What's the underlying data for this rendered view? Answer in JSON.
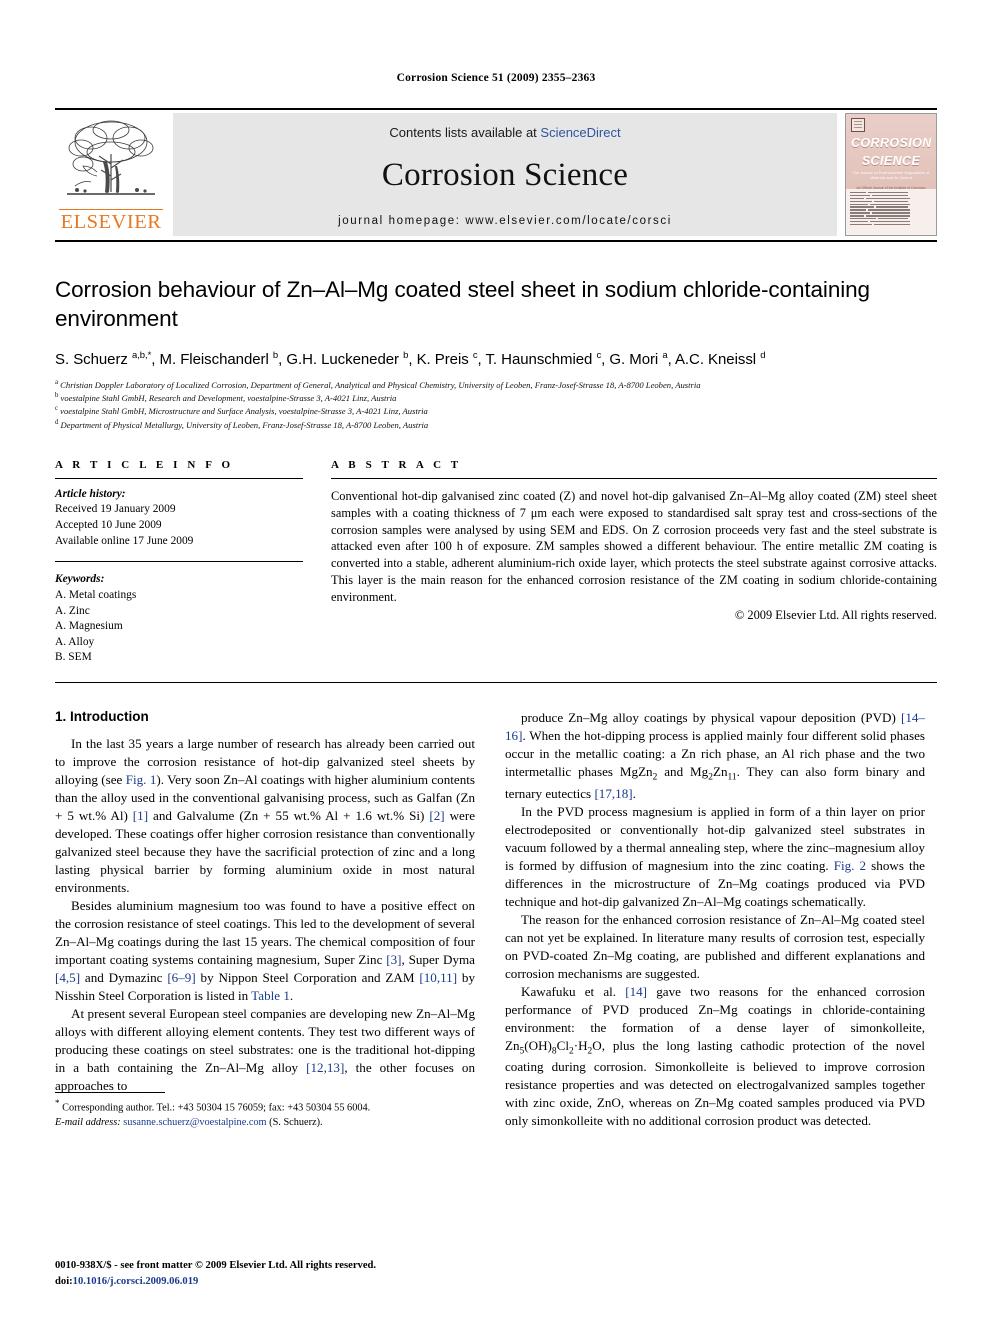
{
  "running_head": "Corrosion Science 51 (2009) 2355–2363",
  "masthead": {
    "contents_prefix": "Contents lists available at ",
    "contents_link": "ScienceDirect",
    "journal_name": "Corrosion Science",
    "homepage": "journal homepage: www.elsevier.com/locate/corsci",
    "publisher_word": "ELSEVIER",
    "accent_orange": "#E87722",
    "link_blue": "#2f54a0",
    "panel_grey": "#e6e6e6"
  },
  "cover": {
    "title_line1": "CORROSION",
    "title_line2": "SCIENCE",
    "subtitle": "The Journal on Environmental Degradation of Materials and its Control",
    "subtitle2": "An Official Journal of the Institute of Corrosion",
    "contents_caption": "CONTENTS",
    "background": "#e2c2b9"
  },
  "article": {
    "title": "Corrosion behaviour of Zn–Al–Mg coated steel sheet in sodium chloride-containing environment",
    "authors_html": "S. Schuerz <sup>a,b,*</sup>, M. Fleischanderl <sup>b</sup>, G.H. Luckeneder <sup>b</sup>, K. Preis <sup>c</sup>, T. Haunschmied <sup>c</sup>, G. Mori <sup>a</sup>, A.C. Kneissl <sup>d</sup>",
    "affiliations": [
      "Christian Doppler Laboratory of Localized Corrosion, Department of General, Analytical and Physical Chemistry, University of Leoben, Franz-Josef-Strasse 18, A-8700 Leoben, Austria",
      "voestalpine Stahl GmbH, Research and Development, voestalpine-Strasse 3, A-4021 Linz, Austria",
      "voestalpine Stahl GmbH, Microstructure and Surface Analysis, voestalpine-Strasse 3, A-4021 Linz, Austria",
      "Department of Physical Metallurgy, University of Leoben, Franz-Josef-Strasse 18, A-8700 Leoben, Austria"
    ],
    "affiliation_marks": [
      "a",
      "b",
      "c",
      "d"
    ]
  },
  "article_info": {
    "heading": "A R T I C L E    I N F O",
    "history_label": "Article history:",
    "history": [
      "Received 19 January 2009",
      "Accepted 10 June 2009",
      "Available online 17 June 2009"
    ],
    "keywords_label": "Keywords:",
    "keywords": [
      "A. Metal coatings",
      "A. Zinc",
      "A. Magnesium",
      "A. Alloy",
      "B. SEM"
    ]
  },
  "abstract": {
    "heading": "A B S T R A C T",
    "text": "Conventional hot-dip galvanised zinc coated (Z) and novel hot-dip galvanised Zn–Al–Mg alloy coated (ZM) steel sheet samples with a coating thickness of 7 μm each were exposed to standardised salt spray test and cross-sections of the corrosion samples were analysed by using SEM and EDS. On Z corrosion proceeds very fast and the steel substrate is attacked even after 100 h of exposure. ZM samples showed a different behaviour. The entire metallic ZM coating is converted into a stable, adherent aluminium-rich oxide layer, which protects the steel substrate against corrosive attacks. This layer is the main reason for the enhanced corrosion resistance of the ZM coating in sodium chloride-containing environment.",
    "copyright": "© 2009 Elsevier Ltd. All rights reserved."
  },
  "body": {
    "section_title": "1. Introduction",
    "left_paragraphs": [
      "In the last 35 years a large number of research has already been carried out to improve the corrosion resistance of hot-dip galvanized steel sheets by alloying (see |Fig. 1|). Very soon Zn–Al coatings with higher aluminium contents than the alloy used in the conventional galvanising process, such as Galfan (Zn + 5 wt.% Al) |[1]| and Galvalume (Zn + 55 wt.%  Al + 1.6 wt.%  Si) |[2]| were developed. These coatings offer higher corrosion resistance than conventionally galvanized steel because they have the sacrificial protection of zinc and a long lasting physical barrier by forming aluminium oxide in most natural environments.",
      "Besides aluminium magnesium too was found to have a positive effect on the corrosion resistance of steel coatings. This led to the development of several Zn–Al–Mg coatings during the last 15 years. The chemical composition of four important coating systems containing magnesium, Super Zinc |[3]|, Super Dyma |[4,5]| and Dymazinc |[6–9]| by Nippon Steel Corporation and ZAM |[10,11]| by Nisshin Steel Corporation is listed in |Table 1|.",
      "At present several European steel companies are developing new Zn–Al–Mg alloys with different alloying element contents. They test two different ways of producing these coatings on steel substrates: one is the traditional hot-dipping in a bath containing the Zn–Al–Mg alloy |[12,13]|, the other focuses on approaches to"
    ],
    "right_paragraphs": [
      "produce Zn–Mg alloy coatings by physical vapour deposition (PVD) |[14–16]|. When the hot-dipping process is applied mainly four different solid phases occur in the metallic coating: a Zn rich phase, an Al rich phase and the two intermetallic phases MgZn~2~ and Mg~2~Zn~11~. They can also form binary and ternary eutectics |[17,18]|.",
      "In the PVD process magnesium is applied in form of a thin layer on prior electrodeposited or conventionally hot-dip galvanized steel substrates in vacuum followed by a thermal annealing step, where the zinc–magnesium alloy is formed by diffusion of magnesium into the zinc coating. |Fig. 2| shows the differences in the microstructure of Zn–Mg coatings produced via PVD technique and hot-dip galvanized Zn–Al–Mg coatings schematically.",
      "The reason for the enhanced corrosion resistance of Zn–Al–Mg coated steel can not yet be explained. In literature many results of corrosion test, especially on PVD-coated Zn–Mg coating, are published and different explanations and corrosion mechanisms are suggested.",
      "Kawafuku et al. |[14]| gave two reasons for the enhanced corrosion performance of PVD produced Zn–Mg coatings in chloride-containing environment: the formation of a dense layer of simonkolleite, Zn~5~(OH)~8~Cl~2~·H~2~O, plus the long lasting cathodic protection of the novel coating during corrosion. Simonkolleite is believed to improve corrosion resistance properties and was detected on electrogalvanized samples together with zinc oxide, ZnO, whereas on Zn–Mg coated samples produced via PVD only simonkolleite with no additional corrosion product was detected."
    ],
    "reference_color": "#1a3a8f"
  },
  "footnote": {
    "star": "*",
    "corresponding": "Corresponding author. Tel.: +43 50304 15 76059; fax: +43 50304 55 6004.",
    "email_label": "E-mail address:",
    "email": "susanne.schuerz@voestalpine.com",
    "email_suffix": "(S. Schuerz)."
  },
  "footer": {
    "issn_line": "0010-938X/$ - see front matter © 2009 Elsevier Ltd. All rights reserved.",
    "doi_label": "doi:",
    "doi": "10.1016/j.corsci.2009.06.019"
  }
}
